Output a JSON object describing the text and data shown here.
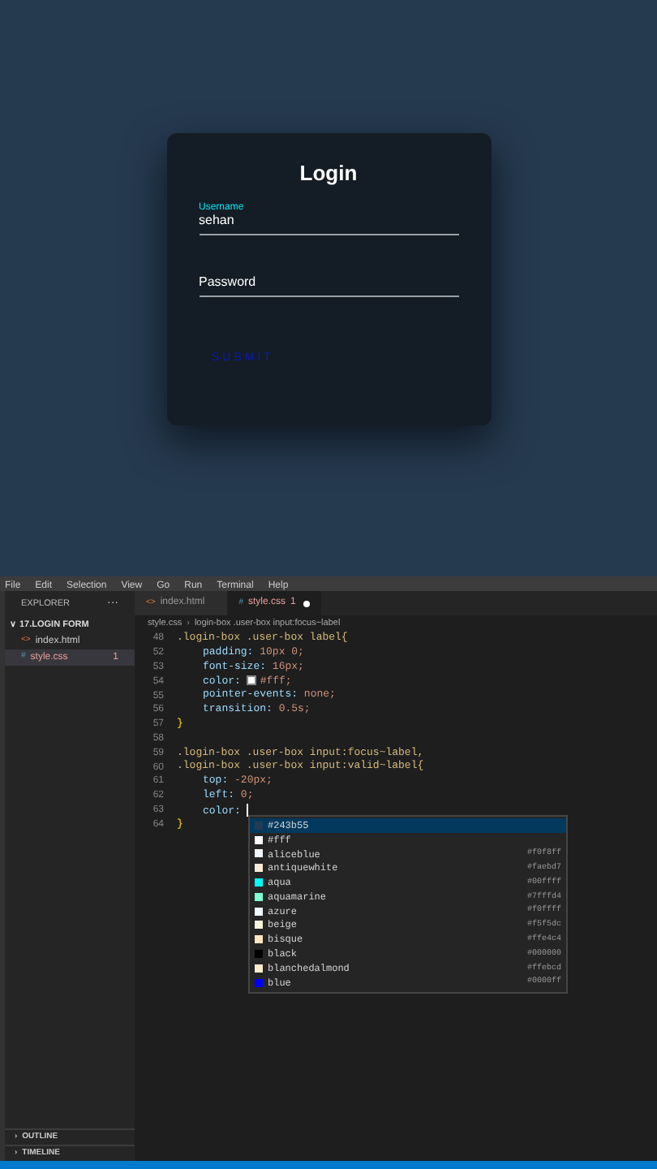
{
  "preview": {
    "title": "Login",
    "fields": [
      {
        "label": "Username",
        "value": "sehan"
      },
      {
        "label": "Password"
      }
    ],
    "submit": "SUBMIT"
  },
  "menu": [
    "File",
    "Edit",
    "Selection",
    "View",
    "Go",
    "Run",
    "Terminal",
    "Help"
  ],
  "sidebar": {
    "title": "EXPLORER",
    "more": "···",
    "folder": "17.LOGIN FORM",
    "chevron": "∨",
    "expanded": true,
    "files": [
      {
        "icon": "<>",
        "name": "index.html",
        "selected": false,
        "modified": false
      },
      {
        "icon": "#",
        "name": "style.css",
        "badge": "1",
        "selected": true,
        "modified": true
      }
    ],
    "panels": [
      {
        "chevron": "›",
        "label": "OUTLINE",
        "expanded": false
      },
      {
        "chevron": "›",
        "label": "TIMELINE",
        "expanded": false
      }
    ]
  },
  "tabs": [
    {
      "icon": "<>",
      "label": "index.html",
      "selected": false,
      "dirty": false
    },
    {
      "icon": "#",
      "label": "style.css",
      "badge": "1",
      "selected": true,
      "dirty": true
    }
  ],
  "breadcrumb": {
    "separator": "›",
    "items": [
      "style.css",
      "login-box .user-box input:focus~label"
    ]
  },
  "code": [
    {
      "number": "48",
      "kind": "selector",
      "text": ".login-box .user-box label{"
    },
    {
      "number": "52",
      "kind": "decl",
      "property": "padding:",
      "value": "10px 0;"
    },
    {
      "number": "53",
      "kind": "decl",
      "property": "font-size:",
      "value": "16px;"
    },
    {
      "number": "54",
      "kind": "decl",
      "property": "color:",
      "value": "#fff;",
      "swatch": true
    },
    {
      "number": "55",
      "kind": "decl",
      "property": "pointer-events:",
      "value": "none;"
    },
    {
      "number": "56",
      "kind": "decl",
      "property": "transition:",
      "value": "0.5s;"
    },
    {
      "number": "57",
      "kind": "brace",
      "text": "}"
    },
    {
      "number": "58",
      "kind": "blank"
    },
    {
      "number": "59",
      "kind": "selector",
      "text": ".login-box .user-box input:focus~label,"
    },
    {
      "number": "60",
      "kind": "selector",
      "text": ".login-box .user-box input:valid~label{"
    },
    {
      "number": "61",
      "kind": "decl",
      "property": "top:",
      "value": "-20px;"
    },
    {
      "number": "62",
      "kind": "decl",
      "property": "left:",
      "value": "0;"
    },
    {
      "number": "63",
      "kind": "decl",
      "property": "color:",
      "cursor": true
    },
    {
      "number": "64",
      "kind": "brace",
      "text": "}"
    }
  ],
  "suggestions": [
    {
      "label": "#243b55",
      "color": "#243b55",
      "selected": true
    },
    {
      "label": "#fff",
      "color": "#ffffff",
      "selected": false
    },
    {
      "label": "aliceblue",
      "hex": "#f0f8ff",
      "color": "#f0f8ff",
      "selected": false
    },
    {
      "label": "antiquewhite",
      "hex": "#faebd7",
      "color": "#faebd7",
      "selected": false
    },
    {
      "label": "aqua",
      "hex": "#00ffff",
      "color": "#00ffff",
      "selected": false
    },
    {
      "label": "aquamarine",
      "hex": "#7fffd4",
      "color": "#7fffd4",
      "selected": false
    },
    {
      "label": "azure",
      "hex": "#f0ffff",
      "color": "#f0ffff",
      "selected": false
    },
    {
      "label": "beige",
      "hex": "#f5f5dc",
      "color": "#f5f5dc",
      "selected": false
    },
    {
      "label": "bisque",
      "hex": "#ffe4c4",
      "color": "#ffe4c4",
      "selected": false
    },
    {
      "label": "black",
      "hex": "#000000",
      "color": "#000000",
      "selected": false
    },
    {
      "label": "blanchedalmond",
      "hex": "#ffebcd",
      "color": "#ffebcd",
      "selected": false
    },
    {
      "label": "blue",
      "hex": "#0000ff",
      "color": "#0000ff",
      "selected": false
    }
  ]
}
